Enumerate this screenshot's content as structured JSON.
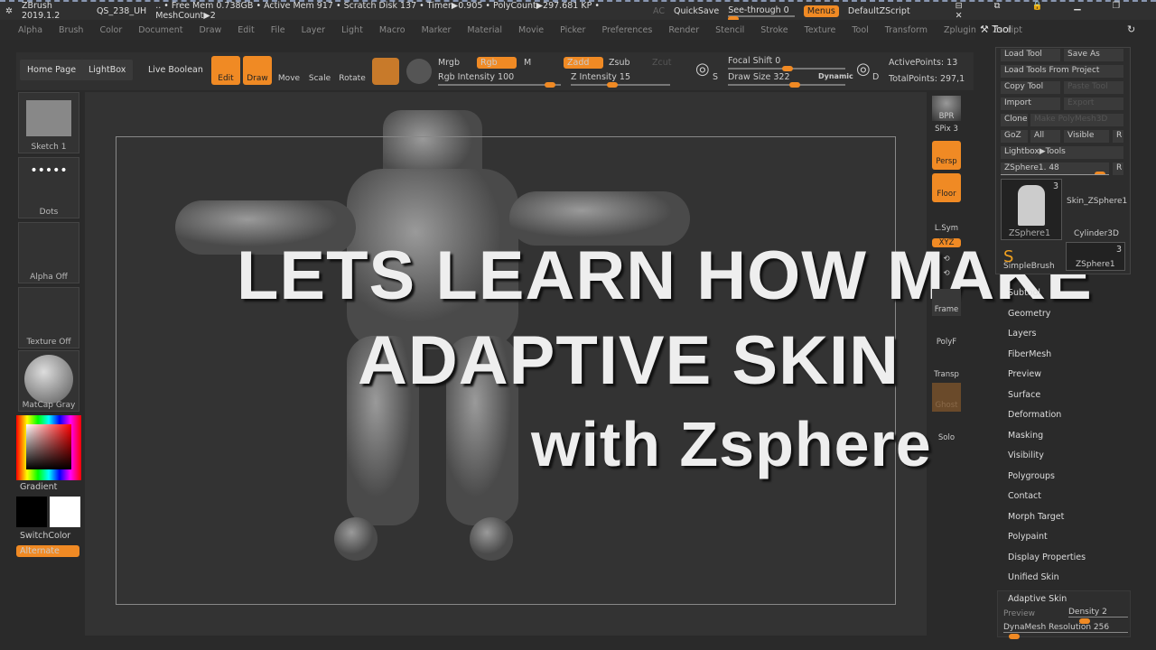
{
  "titlebar": {
    "app": "ZBrush 2019.1.2",
    "doc": "QS_238_UH",
    "stats": ".. • Free Mem 0.738GB • Active Mem 917 • Scratch Disk 137 • Timer▶0.905 • PolyCount▶297.681 KP • MeshCount▶2",
    "ac": "AC",
    "quicksave": "QuickSave",
    "see_through": "See-through  0",
    "see_through_value": 0,
    "menus": "Menus",
    "script": "DefaultZScript"
  },
  "menu": [
    "Alpha",
    "Brush",
    "Color",
    "Document",
    "Draw",
    "Edit",
    "File",
    "Layer",
    "Light",
    "Macro",
    "Marker",
    "Material",
    "Movie",
    "Picker",
    "Preferences",
    "Render",
    "Stencil",
    "Stroke",
    "Texture",
    "Tool",
    "Transform",
    "Zplugin",
    "Zscript"
  ],
  "toolbar": {
    "home": "Home Page",
    "lightbox": "LightBox",
    "live_boolean": "Live Boolean",
    "edit": "Edit",
    "draw": "Draw",
    "move": "Move",
    "scale": "Scale",
    "rotate": "Rotate",
    "mrgb": "Mrgb",
    "rgb": "Rgb",
    "m": "M",
    "zadd": "Zadd",
    "zsub": "Zsub",
    "zcut": "Zcut",
    "rgb_intensity": "Rgb Intensity 100",
    "z_intensity": "Z Intensity 15",
    "focal_shift": "Focal Shift 0",
    "draw_size": "Draw Size 322",
    "dynamic": "Dynamic",
    "active_points": "ActivePoints: 13",
    "total_points": "TotalPoints: 297,1",
    "s": "S",
    "d": "D"
  },
  "left": {
    "brush": "Sketch 1",
    "stroke": "Dots",
    "alpha": "Alpha Off",
    "texture": "Texture Off",
    "material": "MatCap Gray",
    "gradient": "Gradient",
    "switch": "SwitchColor",
    "alternate": "Alternate"
  },
  "overlay": {
    "line1": "LETS LEARN HOW MAKE",
    "line2": "ADAPTIVE SKIN",
    "line3": "with Zsphere"
  },
  "rightstrip": {
    "bpr": "BPR",
    "spix": "SPix 3",
    "persp": "Persp",
    "floor": "Floor",
    "lsym": "L.Sym",
    "xyz": "XYZ",
    "frame": "Frame",
    "polyf": "PolyF",
    "transp": "Transp",
    "ghost": "Ghost",
    "solo": "Solo"
  },
  "panel": {
    "title": "Tool",
    "load_tool": "Load Tool",
    "save_as": "Save As",
    "load_project": "Load Tools From Project",
    "copy_tool": "Copy Tool",
    "paste_tool": "Paste Tool",
    "import": "Import",
    "export": "Export",
    "clone": "Clone",
    "make_polymesh": "Make PolyMesh3D",
    "goz": "GoZ",
    "all": "All",
    "visible": "Visible",
    "r": "R",
    "lightbox_tools": "Lightbox▶Tools",
    "zsphere_slider": "ZSphere1. 48",
    "tools": [
      {
        "name": "ZSphere1",
        "count": "3"
      },
      {
        "name": "Skin_ZSphere1"
      },
      {
        "name": "Cylinder3D"
      },
      {
        "name": "SimpleBrush"
      },
      {
        "name": "ZSphere1",
        "count": "3"
      }
    ],
    "subpalettes": [
      "Subtool",
      "Geometry",
      "Layers",
      "FiberMesh",
      "Preview",
      "Surface",
      "Deformation",
      "Masking",
      "Visibility",
      "Polygroups",
      "Contact",
      "Morph Target",
      "Polypaint",
      "Display Properties",
      "Unified Skin"
    ],
    "adaptive": {
      "title": "Adaptive Skin",
      "preview": "Preview",
      "density": "Density 2",
      "dynamesh": "DynaMesh Resolution 256"
    }
  },
  "colors": {
    "accent": "#f08a24",
    "bg": "#2a2a2a"
  }
}
